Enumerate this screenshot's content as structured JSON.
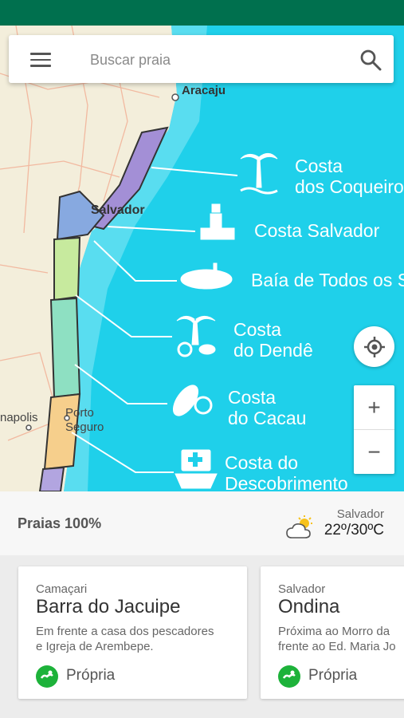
{
  "search": {
    "placeholder": "Buscar praia"
  },
  "map": {
    "cities": [
      "Aracaju",
      "Salvador",
      "Porto",
      "Seguro",
      "napolis"
    ],
    "coasts": [
      {
        "line1": "Costa",
        "line2": "dos Coqueiros"
      },
      {
        "line1": "Costa Salvador"
      },
      {
        "line1": "Baía de Todos os Santos"
      },
      {
        "line1": "Costa",
        "line2": "do Dendê"
      },
      {
        "line1": "Costa",
        "line2": "do Cacau"
      },
      {
        "line1": "Costa do",
        "line2": "Descobrimento"
      }
    ],
    "zoom_in": "+",
    "zoom_out": "−"
  },
  "info": {
    "praias_label": "Praias 100%",
    "weather_city": "Salvador",
    "weather_temp": "22º/30ºC"
  },
  "cards": [
    {
      "city": "Camaçari",
      "name": "Barra do Jacuipe",
      "desc_line1": "Em frente a casa dos pescadores",
      "desc_line2": "e Igreja de Arembepe.",
      "status": "Própria"
    },
    {
      "city": "Salvador",
      "name": "Ondina",
      "desc_line1": "Próxima ao Morro da",
      "desc_line2": "frente ao Ed. Maria Jo",
      "status": "Própria"
    }
  ],
  "colors": {
    "status_bar": "#00704e",
    "ocean": "#1fd0ea",
    "status_ok": "#1db23a"
  }
}
